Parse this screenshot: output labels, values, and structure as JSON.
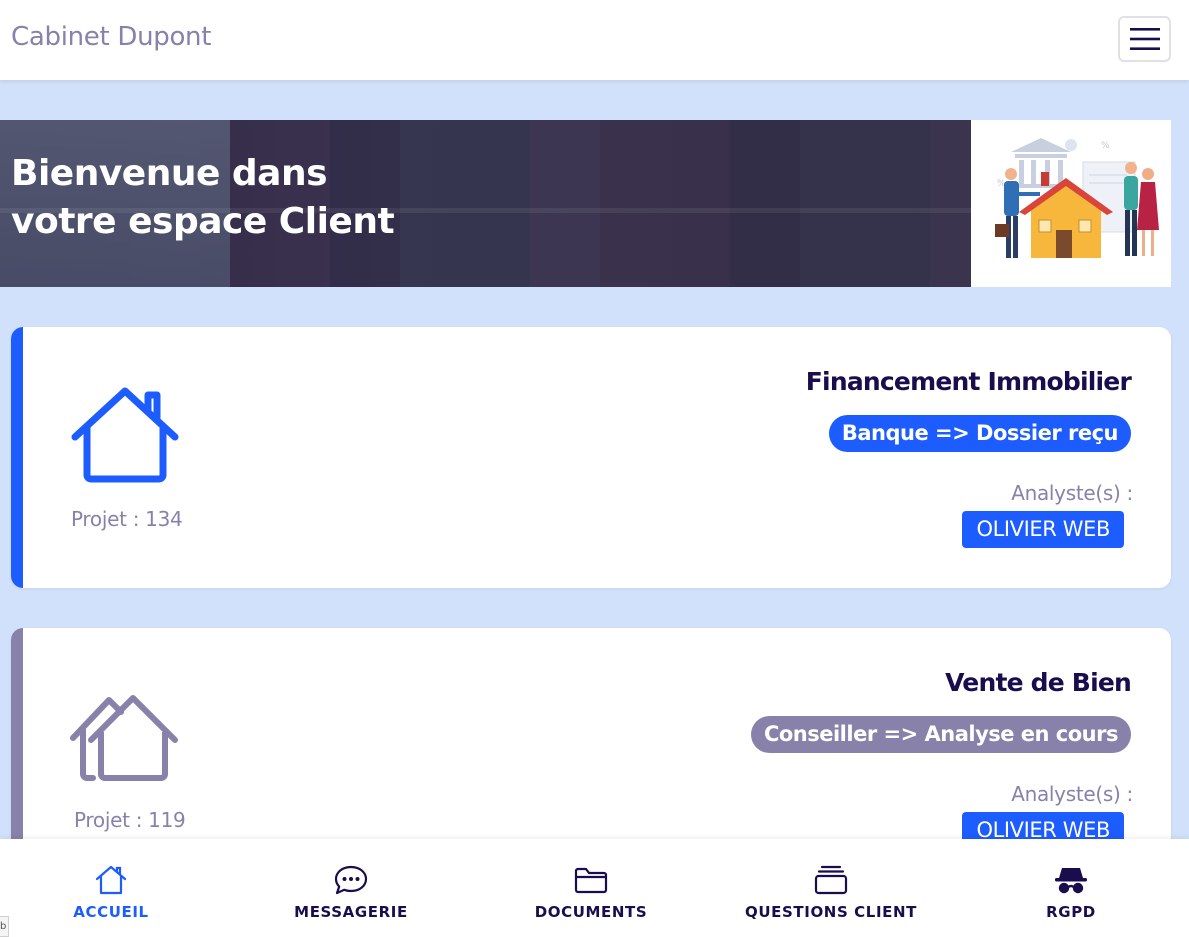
{
  "navbar": {
    "brand": "Cabinet Dupont",
    "menu_icon": "hamburger-menu-icon"
  },
  "hero": {
    "title_line1": "Bienvenue dans",
    "title_line2": "votre espace Client",
    "illustration": "mortgage-house-illustration"
  },
  "projects": [
    {
      "title": "Financement Immobilier",
      "status": "Banque => Dossier reçu",
      "project_label": "Projet : 134",
      "analyst_label": "Analyste(s) :",
      "analyst": "OLIVIER WEB",
      "icon": "house-icon",
      "state": "active",
      "accent_color": "#1d5cff"
    },
    {
      "title": "Vente de Bien",
      "status": "Conseiller => Analyse en cours",
      "project_label": "Projet : 119",
      "analyst_label": "Analyste(s) :",
      "analyst": "OLIVIER WEB",
      "icon": "houses-icon",
      "state": "inactive",
      "accent_color": "#8882ab"
    }
  ],
  "bottom_nav": [
    {
      "label": "ACCUEIL",
      "icon": "home-icon",
      "selected": true
    },
    {
      "label": "MESSAGERIE",
      "icon": "chat-bubble-icon",
      "selected": false
    },
    {
      "label": "DOCUMENTS",
      "icon": "folder-icon",
      "selected": false
    },
    {
      "label": "QUESTIONS CLIENT",
      "icon": "stack-icon",
      "selected": false
    },
    {
      "label": "RGPD",
      "icon": "incognito-icon",
      "selected": false
    }
  ],
  "corner_fragment": "b",
  "colors": {
    "background": "#d2e1fb",
    "primary": "#1d5cff",
    "muted": "#8882ab",
    "dark_text": "#1a0d4d"
  }
}
